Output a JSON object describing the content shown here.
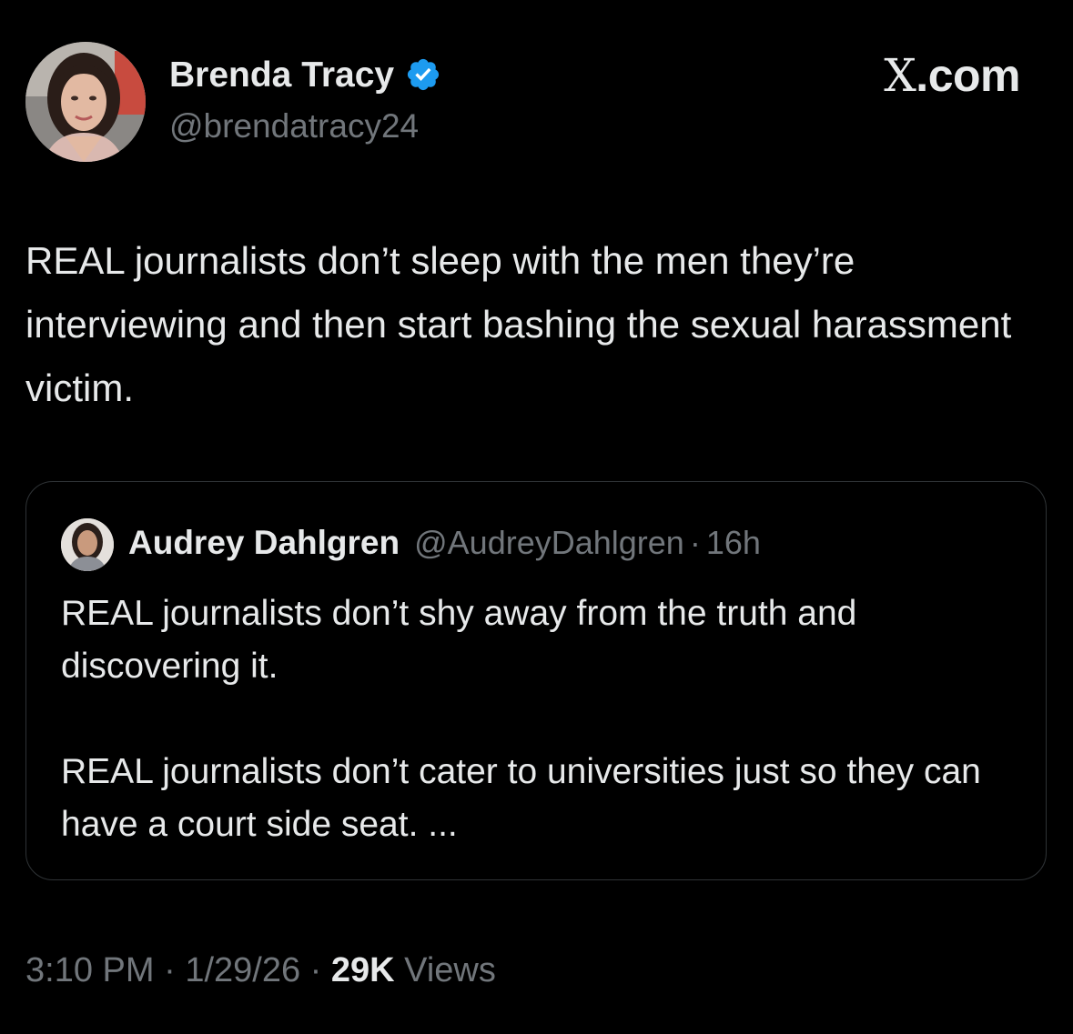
{
  "author": {
    "name": "Brenda Tracy",
    "handle": "@brendatracy24",
    "verified": true
  },
  "watermark": {
    "x": "X",
    "domain": ".com"
  },
  "tweet": {
    "text": "REAL journalists don’t sleep with the men they’re interviewing and then start bashing the sexual harassment victim."
  },
  "quote": {
    "name": "Audrey Dahlgren",
    "handle": "@AudreyDahlgren",
    "dot": "·",
    "time": "16h",
    "paragraphs": [
      "REAL journalists don’t shy away from the truth and discovering it.",
      "REAL journalists don’t cater to universities just so they can have a court side seat. ..."
    ]
  },
  "meta": {
    "time": "3:10 PM",
    "sep": "·",
    "date": "1/29/26",
    "views_count": "29K",
    "views_label": "Views"
  },
  "colors": {
    "background": "#000000",
    "text": "#e7e9ea",
    "muted": "#71767b",
    "border": "#2f3336",
    "verified": "#1d9bf0"
  }
}
